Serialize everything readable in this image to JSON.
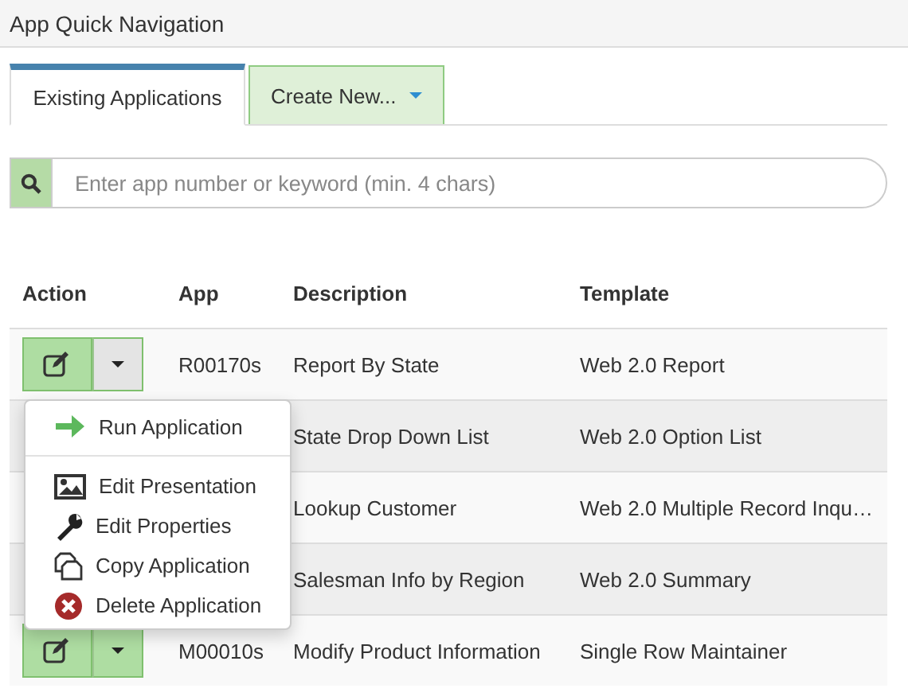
{
  "window": {
    "title": "App Quick Navigation"
  },
  "tabs": [
    {
      "label": "Existing Applications",
      "selected": true,
      "dropdown": false
    },
    {
      "label": "Create New...",
      "selected": false,
      "dropdown": true
    }
  ],
  "search": {
    "placeholder": "Enter app number or keyword (min. 4 chars)"
  },
  "table": {
    "columns": [
      "Action",
      "App",
      "Description",
      "Template"
    ],
    "rows": [
      {
        "app": "R00170s",
        "description": "Report By State",
        "template": "Web 2.0 Report",
        "menu_open": true
      },
      {
        "description": "State Drop Down List",
        "template": "Web 2.0 Option List"
      },
      {
        "description": "Lookup Customer",
        "template": "Web 2.0 Multiple Record Inqu…"
      },
      {
        "description": "Salesman Info by Region",
        "template": "Web 2.0 Summary"
      },
      {
        "app": "M00010s",
        "description": "Modify Product Information",
        "template": "Single Row Maintainer",
        "menu_open": false
      }
    ]
  },
  "action_menu": {
    "items": [
      {
        "kind": "run",
        "label": "Run Application"
      },
      {
        "kind": "divider"
      },
      {
        "kind": "presentation",
        "label": "Edit Presentation"
      },
      {
        "kind": "properties",
        "label": "Edit Properties"
      },
      {
        "kind": "copy",
        "label": "Copy Application"
      },
      {
        "kind": "delete",
        "label": "Delete Application"
      }
    ]
  }
}
